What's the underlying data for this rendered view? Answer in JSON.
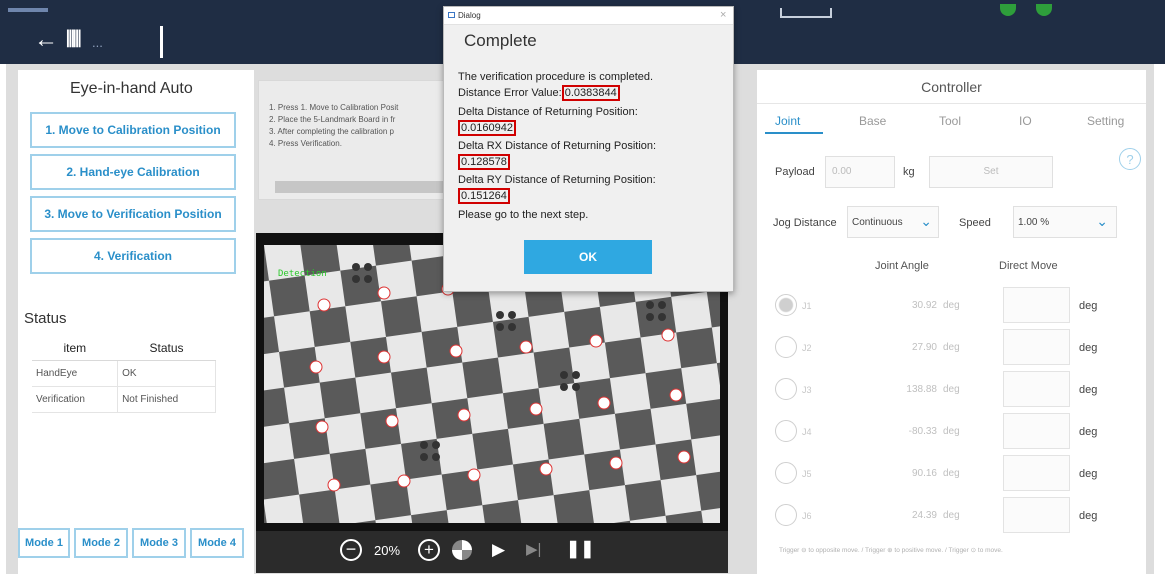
{
  "topbar": {
    "back_icon": "back-arrow-icon",
    "settings_icon": "sliders-icon",
    "more_label": "..."
  },
  "left_panel": {
    "title": "Eye-in-hand Auto",
    "steps": [
      "1. Move to Calibration Position",
      "2. Hand-eye Calibration",
      "3. Move to Verification Position",
      "4. Verification"
    ],
    "status_title": "Status",
    "table_headers": [
      "item",
      "Status"
    ],
    "table_rows": [
      [
        "HandEye",
        "OK"
      ],
      [
        "Verification",
        "Not Finished"
      ]
    ],
    "modes": [
      "Mode 1",
      "Mode 2",
      "Mode 3",
      "Mode 4"
    ]
  },
  "instructions": {
    "lines": [
      "1. Press 1. Move to Calibration Posit",
      "2. Place the 5-Landmark Board in fr",
      "3. After completing the calibration p",
      "4. Press Verification."
    ]
  },
  "camera": {
    "detection_label": "Detection",
    "zoom": "20%",
    "accent_detect": "#2bc82b"
  },
  "dialog": {
    "window_title": "Dialog",
    "heading": "Complete",
    "line1": "The verification procedure is completed.",
    "distance_error_label": "Distance Error Value:",
    "distance_error_value": "0.0383844",
    "delta_distance_label": "Delta Distance of Returning Position:",
    "delta_distance_value": "0.0160942",
    "delta_rx_label": "Delta RX Distance of Returning Position:",
    "delta_rx_value": "0.128578",
    "delta_ry_label": "Delta RY Distance of Returning Position:",
    "delta_ry_value": "0.151264",
    "next_step": "Please go to the next step.",
    "ok_label": "OK",
    "highlight_color": "#d00000",
    "ok_color": "#2fa8e1"
  },
  "controller": {
    "title": "Controller",
    "tabs": [
      "Joint",
      "Base",
      "Tool",
      "IO",
      "Setting"
    ],
    "help_label": "?",
    "payload_label": "Payload",
    "payload_value": "0.00",
    "payload_unit": "kg",
    "set_label": "Set",
    "jog_distance_label": "Jog Distance",
    "jog_distance_value": "Continuous",
    "speed_label": "Speed",
    "speed_value": "1.00 %",
    "joint_angle_header": "Joint Angle",
    "direct_move_header": "Direct Move",
    "joints": [
      {
        "name": "J1",
        "value": "30.92",
        "unit": "deg",
        "direct_unit": "deg"
      },
      {
        "name": "J2",
        "value": "27.90",
        "unit": "deg",
        "direct_unit": "deg"
      },
      {
        "name": "J3",
        "value": "138.88",
        "unit": "deg",
        "direct_unit": "deg"
      },
      {
        "name": "J4",
        "value": "-80.33",
        "unit": "deg",
        "direct_unit": "deg"
      },
      {
        "name": "J5",
        "value": "90.16",
        "unit": "deg",
        "direct_unit": "deg"
      },
      {
        "name": "J6",
        "value": "24.39",
        "unit": "deg",
        "direct_unit": "deg"
      }
    ],
    "footer_note": "Trigger ⊖ to opposite move.  /  Trigger ⊕ to positive move.  /  Trigger ⊙ to move.",
    "accent": "#2a8fc9"
  }
}
